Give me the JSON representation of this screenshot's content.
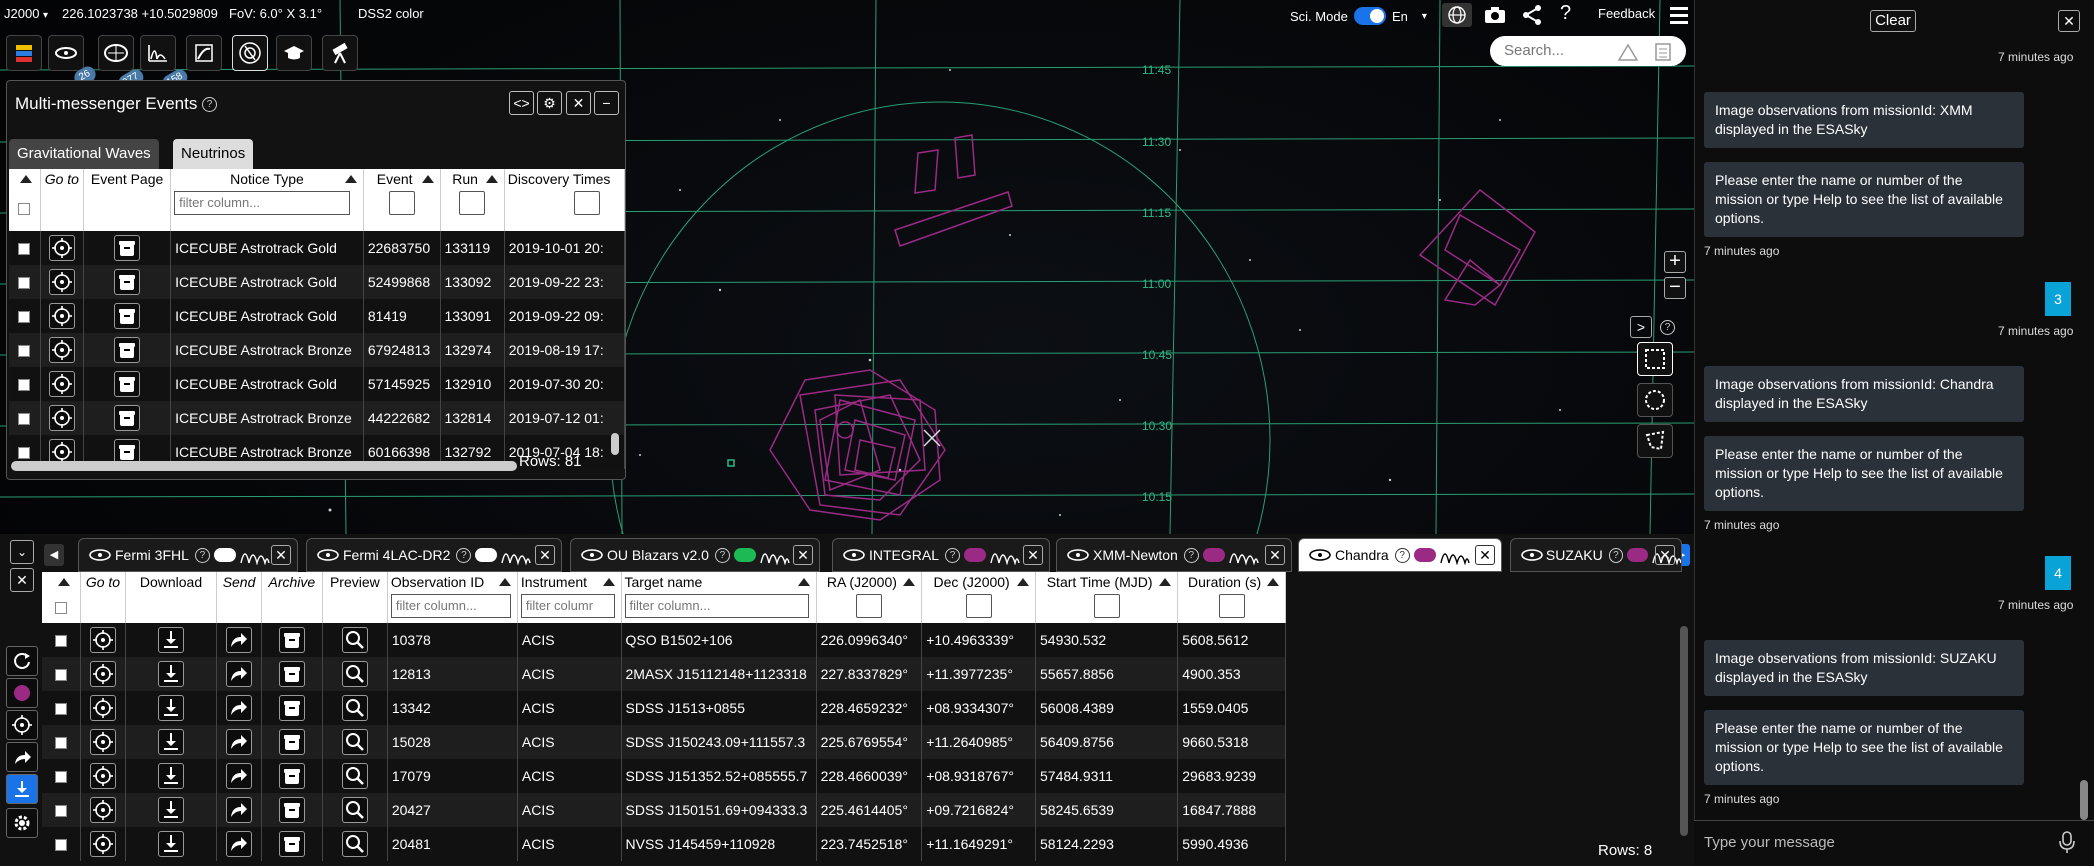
{
  "topbar": {
    "frame": "J2000",
    "coords": "226.1023738 +10.5029809",
    "fov": "FoV: 6.0° X 3.1°",
    "survey": "DSS2 color",
    "sci_mode": "Sci. Mode",
    "lang": "En",
    "feedback": "Feedback",
    "search_placeholder": "Search..."
  },
  "tool_badges": [
    "26",
    "977",
    "158"
  ],
  "grid_labels": [
    "11:45",
    "11:30",
    "11:15",
    "11:00",
    "10:45",
    "10:30",
    "10:15"
  ],
  "mm_panel": {
    "title": "Multi-messenger Events",
    "tabs": [
      "Gravitational Waves",
      "Neutrinos"
    ],
    "active_tab": 1,
    "columns": [
      "Go to",
      "Event Page",
      "Notice Type",
      "Event",
      "Run",
      "Discovery Times"
    ],
    "filter_placeholder": "filter column...",
    "rows": [
      {
        "notice": "ICECUBE Astrotrack Gold",
        "event": "22683750",
        "run": "133119",
        "time": "2019-10-01 20:"
      },
      {
        "notice": "ICECUBE Astrotrack Gold",
        "event": "52499868",
        "run": "133092",
        "time": "2019-09-22 23:"
      },
      {
        "notice": "ICECUBE Astrotrack Gold",
        "event": "81419",
        "run": "133091",
        "time": "2019-09-22 09:"
      },
      {
        "notice": "ICECUBE Astrotrack Bronze",
        "event": "67924813",
        "run": "132974",
        "time": "2019-08-19 17:"
      },
      {
        "notice": "ICECUBE Astrotrack Gold",
        "event": "57145925",
        "run": "132910",
        "time": "2019-07-30 20:"
      },
      {
        "notice": "ICECUBE Astrotrack Bronze",
        "event": "44222682",
        "run": "132814",
        "time": "2019-07-12 01:"
      },
      {
        "notice": "ICECUBE Astrotrack Bronze",
        "event": "60166398",
        "run": "132792",
        "time": "2019-07-04 18:"
      }
    ],
    "rows_count": "Rows: 81"
  },
  "mission_tabs": [
    "Fermi 3FHL",
    "Fermi 4LAC-DR2",
    "OU Blazars v2.0",
    "INTEGRAL",
    "XMM-Newton",
    "Chandra",
    "SUZAKU"
  ],
  "active_mission": "Chandra",
  "colors": {
    "chandra": "#9b2a84",
    "grid": "#2fb785",
    "accent": "#1a73e8",
    "chat_user": "#0aa3d8"
  },
  "obs_table": {
    "columns": [
      "Go to",
      "Download",
      "Send",
      "Archive",
      "Preview",
      "Observation ID",
      "Instrument",
      "Target name",
      "RA (J2000)",
      "Dec (J2000)",
      "Start Time (MJD)",
      "Duration (s)"
    ],
    "filter_placeholders": [
      "filter column...",
      "filter columr",
      "filter column..."
    ],
    "rows": [
      {
        "id": "10378",
        "inst": "ACIS",
        "target": "QSO B1502+106",
        "ra": "226.0996340°",
        "dec": "+10.4963339°",
        "start": "54930.532",
        "dur": "5608.5612"
      },
      {
        "id": "12813",
        "inst": "ACIS",
        "target": "2MASX J15112148+1123318",
        "ra": "227.8337829°",
        "dec": "+11.3977235°",
        "start": "55657.8856",
        "dur": "4900.353"
      },
      {
        "id": "13342",
        "inst": "ACIS",
        "target": "SDSS J1513+0855",
        "ra": "228.4659232°",
        "dec": "+08.9334307°",
        "start": "56008.4389",
        "dur": "1559.0405"
      },
      {
        "id": "15028",
        "inst": "ACIS",
        "target": "SDSS J150243.09+111557.3",
        "ra": "225.6769554°",
        "dec": "+11.2640985°",
        "start": "56409.8756",
        "dur": "9660.5318"
      },
      {
        "id": "17079",
        "inst": "ACIS",
        "target": "SDSS J151352.52+085555.7",
        "ra": "228.4660039°",
        "dec": "+08.9318767°",
        "start": "57484.9311",
        "dur": "29683.9239"
      },
      {
        "id": "20427",
        "inst": "ACIS",
        "target": "SDSS J150151.69+094333.3",
        "ra": "225.4614405°",
        "dec": "+09.7216824°",
        "start": "58245.6539",
        "dur": "16847.7888"
      },
      {
        "id": "20481",
        "inst": "ACIS",
        "target": "NVSS J145459+110928",
        "ra": "223.7452518°",
        "dec": "+11.1649291°",
        "start": "58124.2293",
        "dur": "5990.4936"
      }
    ],
    "rows_count": "Rows: 8"
  },
  "chat": {
    "clear": "Clear",
    "input_placeholder": "Type your message",
    "items": [
      {
        "type": "ts",
        "text": "7 minutes ago"
      },
      {
        "type": "bot",
        "text": "Image observations from missionId: XMM displayed in the ESASky"
      },
      {
        "type": "bot",
        "text": "Please enter the name or number of the mission or type Help to see the list of available options."
      },
      {
        "type": "ts",
        "text": "7 minutes ago"
      },
      {
        "type": "user",
        "text": "3"
      },
      {
        "type": "ts",
        "text": "7 minutes ago"
      },
      {
        "type": "bot",
        "text": "Image observations from missionId: Chandra displayed in the ESASky"
      },
      {
        "type": "bot",
        "text": "Please enter the name or number of the mission or type Help to see the list of available options."
      },
      {
        "type": "ts",
        "text": "7 minutes ago"
      },
      {
        "type": "user",
        "text": "4"
      },
      {
        "type": "ts",
        "text": "7 minutes ago"
      },
      {
        "type": "bot",
        "text": "Image observations from missionId: SUZAKU displayed in the ESASky"
      },
      {
        "type": "bot",
        "text": "Please enter the name or number of the mission or type Help to see the list of available options."
      },
      {
        "type": "ts",
        "text": "7 minutes ago"
      }
    ]
  }
}
